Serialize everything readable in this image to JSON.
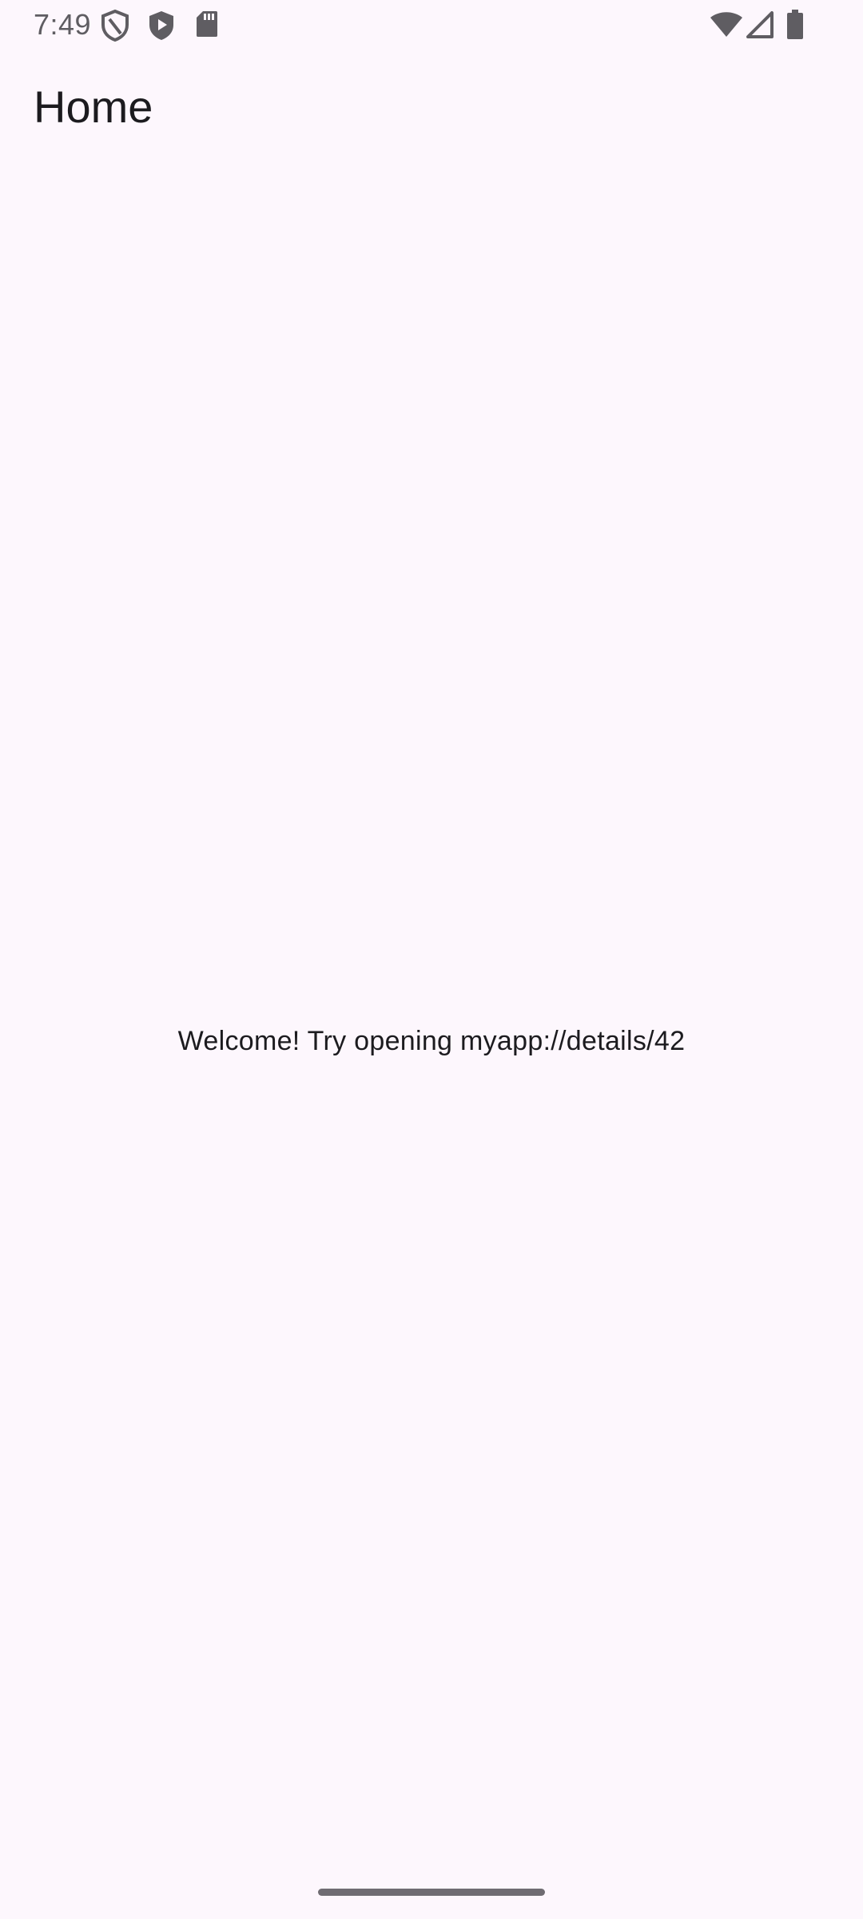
{
  "status_bar": {
    "time": "7:49",
    "left_icons": [
      "shield-icon",
      "play-shield-icon",
      "sd-card-icon"
    ],
    "right_icons": [
      "wifi-icon",
      "cell-signal-icon",
      "battery-icon"
    ],
    "icon_color": "#5f5d62"
  },
  "app_bar": {
    "title": "Home"
  },
  "main": {
    "message": "Welcome! Try opening myapp://details/42"
  },
  "colors": {
    "background": "#FDF7FD",
    "text": "#1C1B1F",
    "gesture_bar": "#6f6c72"
  }
}
